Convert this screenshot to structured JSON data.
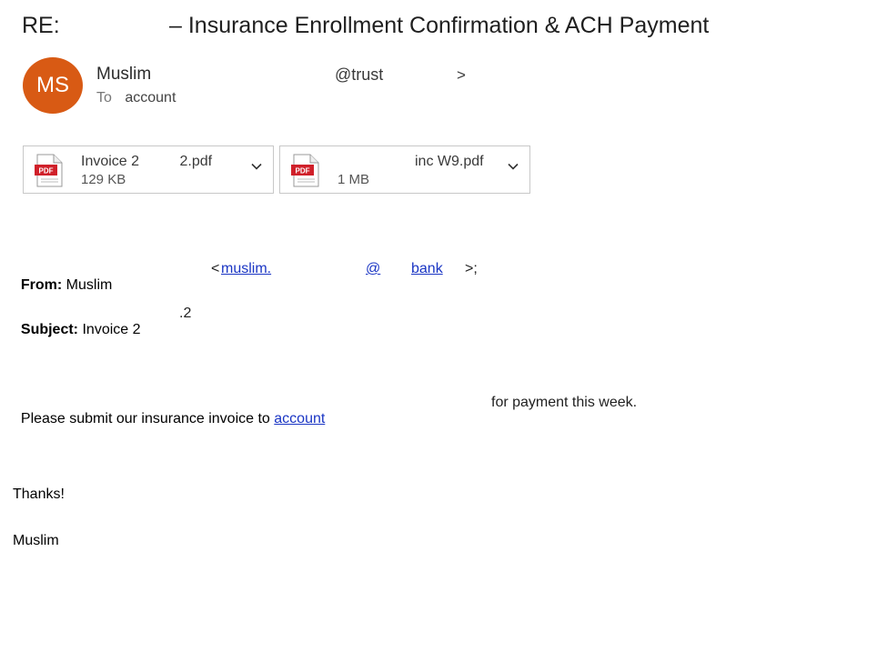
{
  "email": {
    "subject_prefix": "RE:",
    "subject_text": "– Insurance Enrollment Confirmation & ACH Payment",
    "sender": {
      "avatar_initials": "MS",
      "avatar_color": "#d85a14",
      "name": "Muslim",
      "domain_fragment": "@trust",
      "close_bracket": ">"
    },
    "to": {
      "label": "To",
      "value": "account"
    },
    "attachments": [
      {
        "name_fragment": "Invoice 2          2.pdf",
        "size": "129 KB",
        "icon": "pdf-icon"
      },
      {
        "name_fragment": "inc W9.pdf",
        "size": "1 MB",
        "icon": "pdf-icon"
      }
    ]
  },
  "forwarded": {
    "from_label": "From:",
    "from_name": "Muslim",
    "from_open": "<",
    "from_link_1": "muslim.",
    "from_link_2": "@",
    "from_link_3": "bank",
    "from_close": ">;",
    "subject_label": "Subject:",
    "subject_value": "Invoice 2",
    "subject_suffix": ".2"
  },
  "message": {
    "line1_prefix": "Please submit our insurance invoice to",
    "line1_link": "account",
    "line1_suffix": "for payment this week.",
    "thanks": "Thanks!",
    "signature": "Muslim"
  },
  "colors": {
    "link": "#1a35c4",
    "pdf_red": "#d0202a"
  }
}
